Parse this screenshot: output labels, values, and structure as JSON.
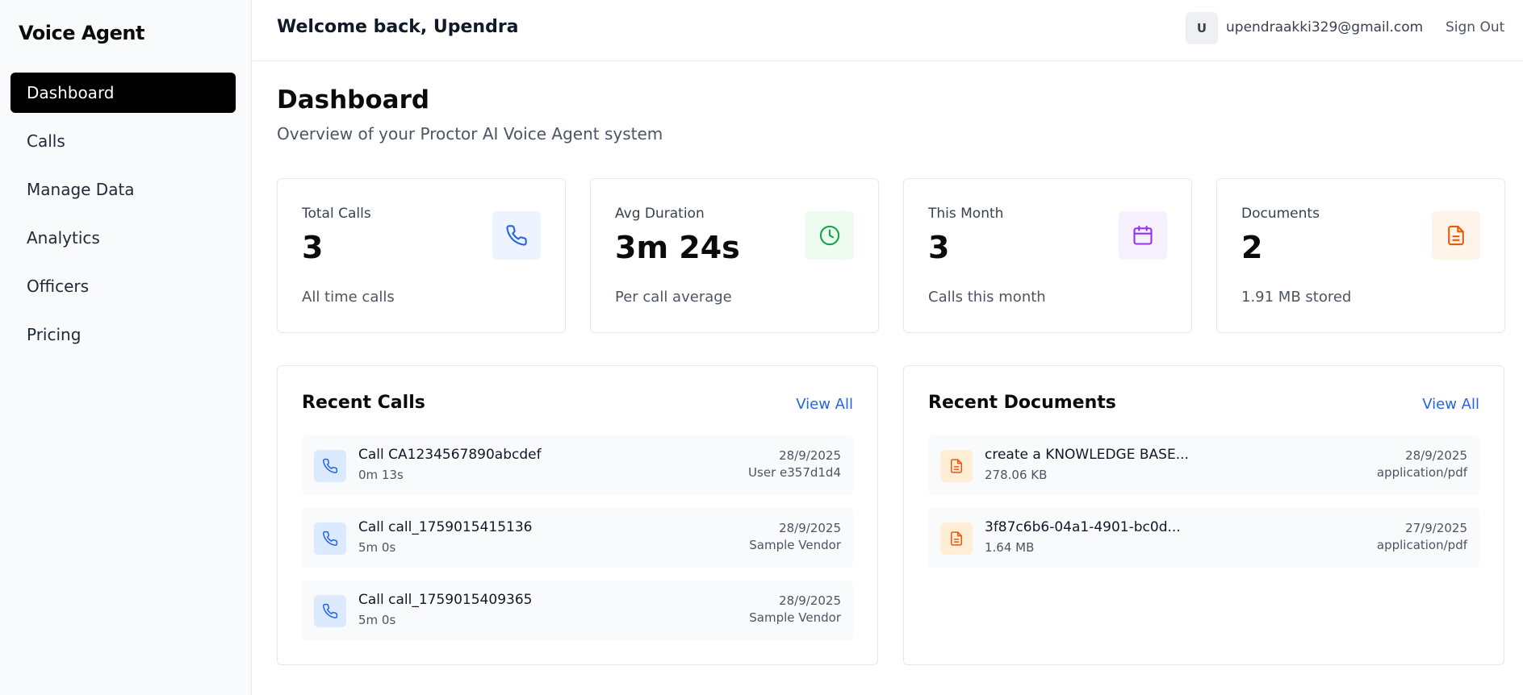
{
  "app": {
    "brand": "Voice Agent"
  },
  "sidebar": {
    "items": [
      {
        "label": "Dashboard",
        "active": true
      },
      {
        "label": "Calls"
      },
      {
        "label": "Manage Data"
      },
      {
        "label": "Analytics"
      },
      {
        "label": "Officers"
      },
      {
        "label": "Pricing"
      }
    ]
  },
  "header": {
    "welcome": "Welcome back, Upendra",
    "avatar_initial": "U",
    "email": "upendraakki329@gmail.com",
    "sign_out": "Sign Out"
  },
  "page": {
    "title": "Dashboard",
    "subtitle": "Overview of your Proctor AI Voice Agent system"
  },
  "stats": [
    {
      "label": "Total Calls",
      "value": "3",
      "note": "All time calls",
      "icon": "phone-icon",
      "accent": "#2563eb",
      "bg": "#eef4ff"
    },
    {
      "label": "Avg Duration",
      "value": "3m 24s",
      "note": "Per call average",
      "icon": "clock-icon",
      "accent": "#16a34a",
      "bg": "#edfbf1"
    },
    {
      "label": "This Month",
      "value": "3",
      "note": "Calls this month",
      "icon": "calendar-icon",
      "accent": "#9333ea",
      "bg": "#f7f0fe"
    },
    {
      "label": "Documents",
      "value": "2",
      "note": "1.91 MB stored",
      "icon": "document-icon",
      "accent": "#ea580c",
      "bg": "#fff4ea"
    }
  ],
  "recent_calls": {
    "title": "Recent Calls",
    "view_all": "View All",
    "items": [
      {
        "title": "Call CA1234567890abcdef",
        "duration": "0m 13s",
        "date": "28/9/2025",
        "meta": "User e357d1d4"
      },
      {
        "title": "Call call_1759015415136",
        "duration": "5m 0s",
        "date": "28/9/2025",
        "meta": "Sample Vendor"
      },
      {
        "title": "Call call_1759015409365",
        "duration": "5m 0s",
        "date": "28/9/2025",
        "meta": "Sample Vendor"
      }
    ]
  },
  "recent_documents": {
    "title": "Recent Documents",
    "view_all": "View All",
    "items": [
      {
        "title": "create a KNOWLEDGE BASE...",
        "size": "278.06 KB",
        "date": "28/9/2025",
        "meta": "application/pdf"
      },
      {
        "title": "3f87c6b6-04a1-4901-bc0d...",
        "size": "1.64 MB",
        "date": "27/9/2025",
        "meta": "application/pdf"
      }
    ]
  },
  "colors": {
    "call_icon_bg": "#dbeafe",
    "call_icon": "#2563eb",
    "doc_icon_bg": "#ffedd5",
    "doc_icon": "#ea580c",
    "link": "#2563eb"
  }
}
